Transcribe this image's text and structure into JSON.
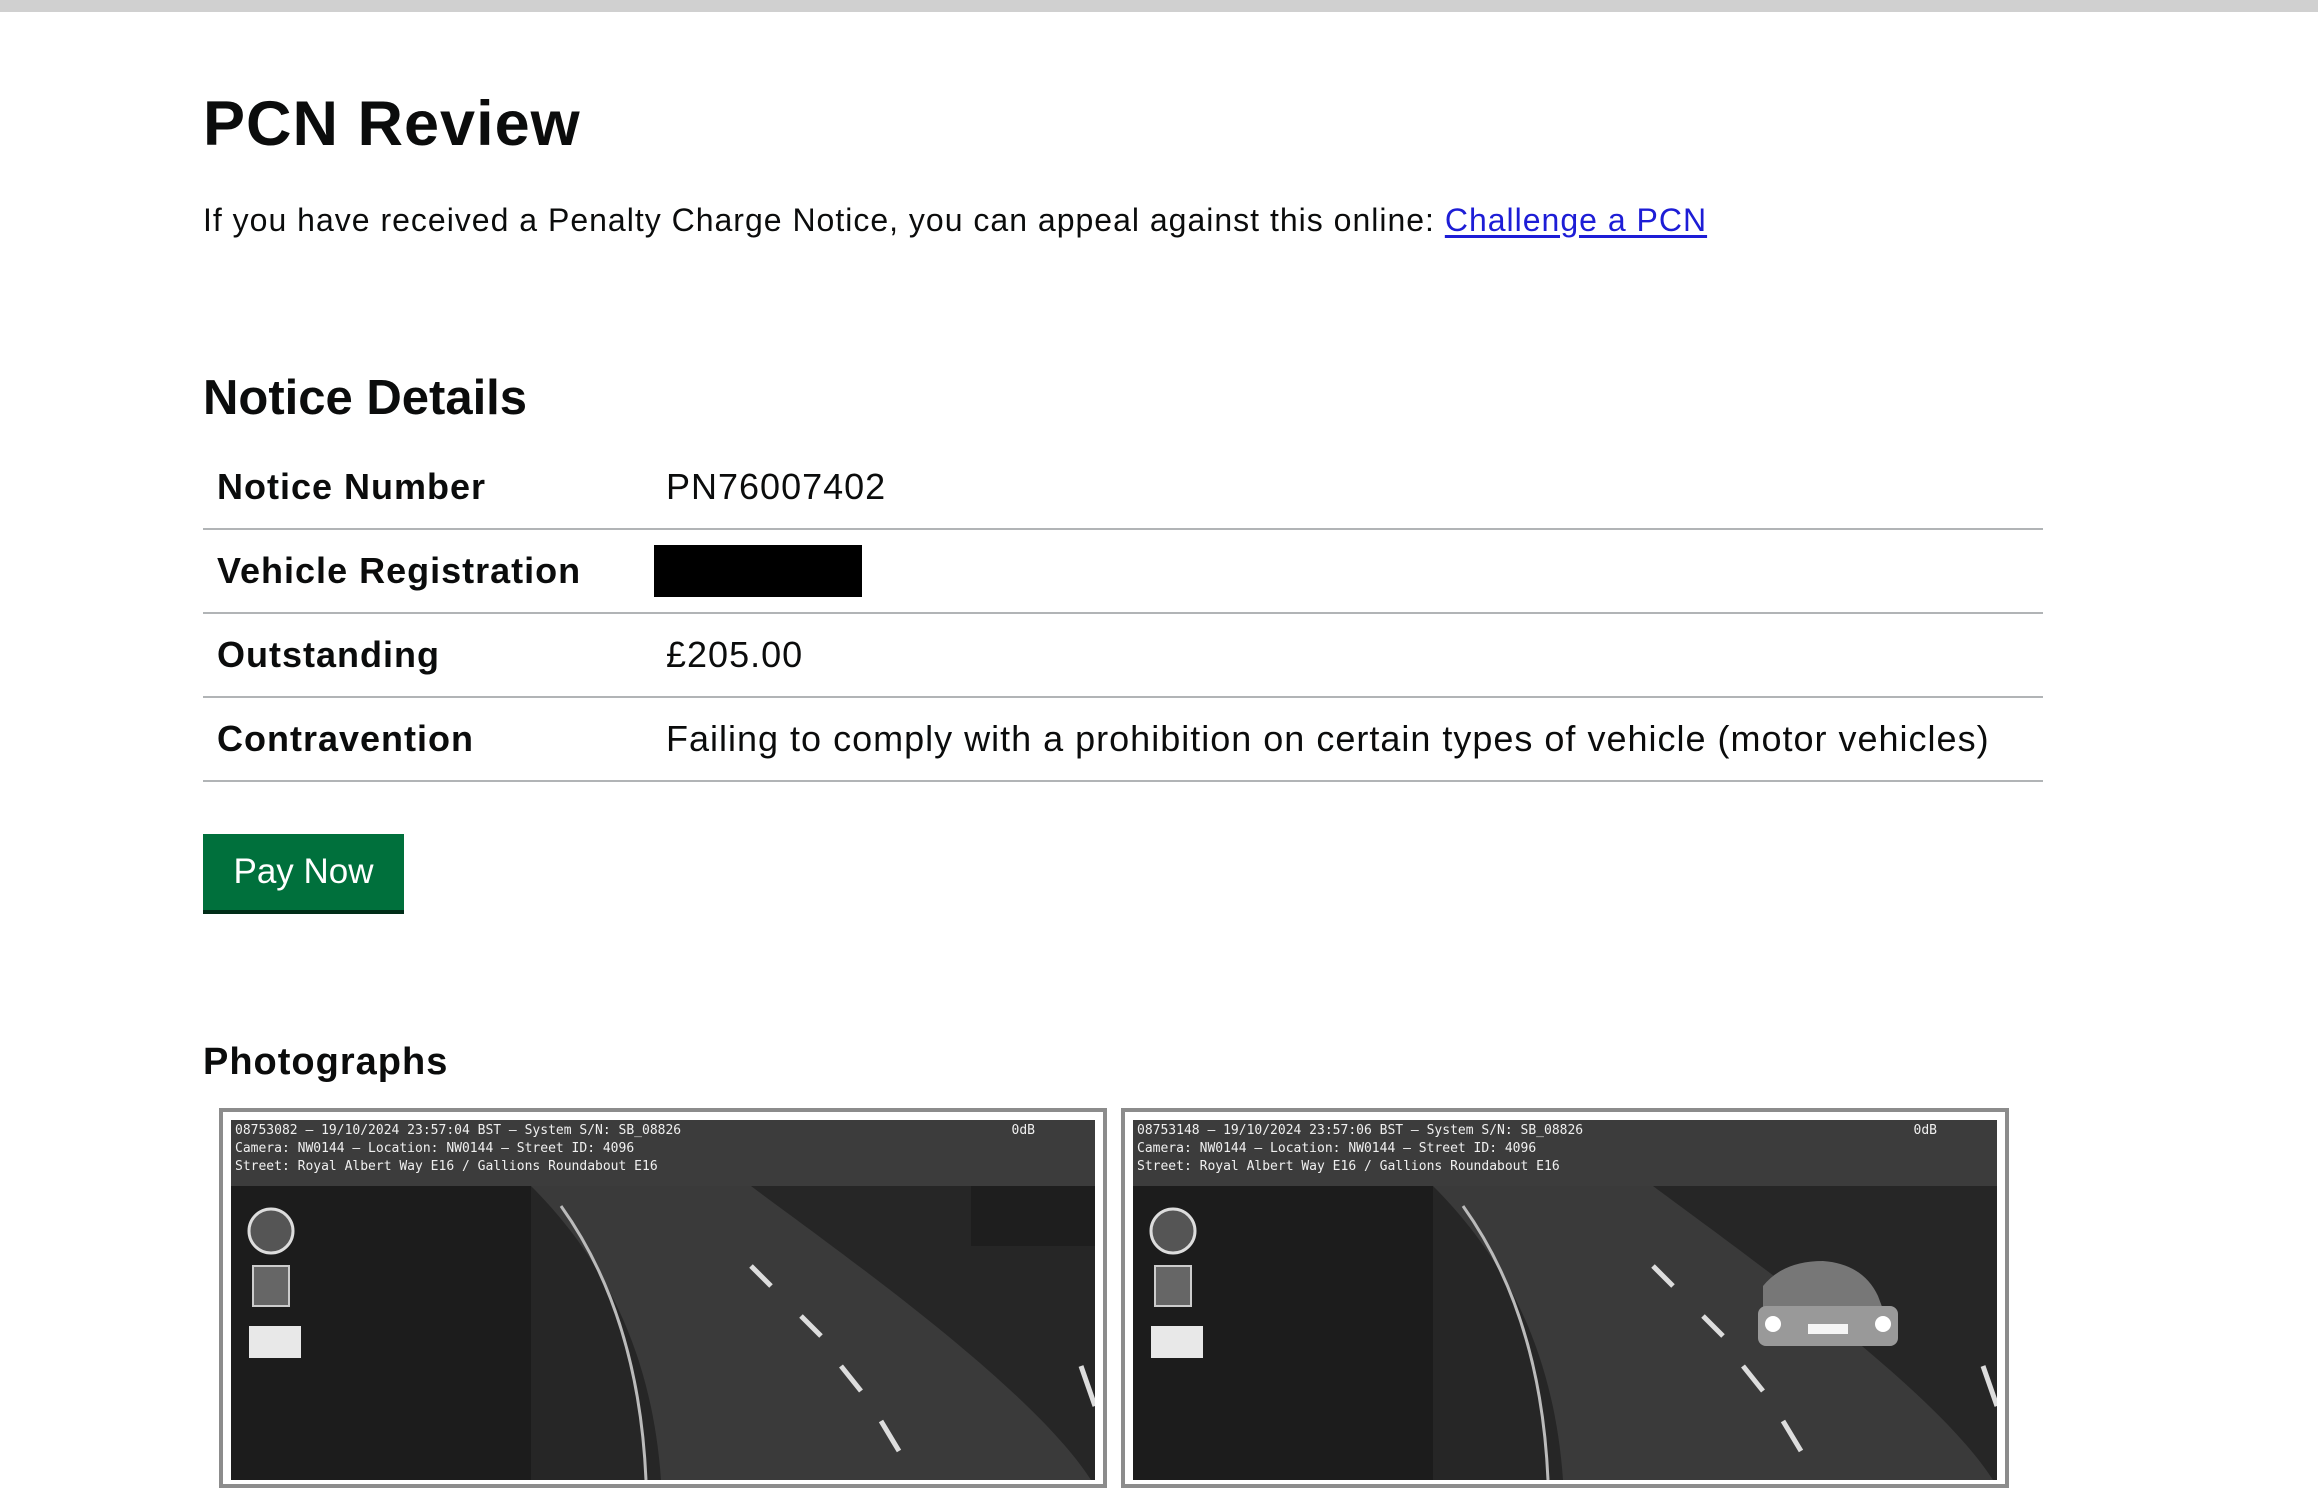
{
  "page": {
    "title": "PCN Review",
    "intro_text": "If you have received a Penalty Charge Notice, you can appeal against this online: ",
    "challenge_link": "Challenge a PCN"
  },
  "notice": {
    "heading": "Notice Details",
    "rows": [
      {
        "label": "Notice Number",
        "value": "PN76007402"
      },
      {
        "label": "Vehicle Registration",
        "value": ""
      },
      {
        "label": "Outstanding",
        "value": "£205.00"
      },
      {
        "label": "Contravention",
        "value": "Failing to comply with a prohibition on certain types of vehicle (motor vehicles)"
      }
    ]
  },
  "actions": {
    "pay_now": "Pay Now"
  },
  "photographs": {
    "heading": "Photographs",
    "items": [
      {
        "line1": "08753082 — 19/10/2024 23:57:04 BST — System S/N: SB_08826",
        "line2": "Camera: NW0144 — Location: NW0144 — Street ID: 4096",
        "line3": "Street: Royal Albert Way E16 / Gallions Roundabout E16",
        "odb": "0dB"
      },
      {
        "line1": "08753148 — 19/10/2024 23:57:06 BST — System S/N: SB_08826",
        "line2": "Camera: NW0144 — Location: NW0144 — Street ID: 4096",
        "line3": "Street: Royal Albert Way E16 / Gallions Roundabout E16",
        "odb": "0dB"
      }
    ]
  },
  "colors": {
    "button_bg": "#00703c",
    "link": "#1d1dd6",
    "divider": "#b1b4b6"
  }
}
